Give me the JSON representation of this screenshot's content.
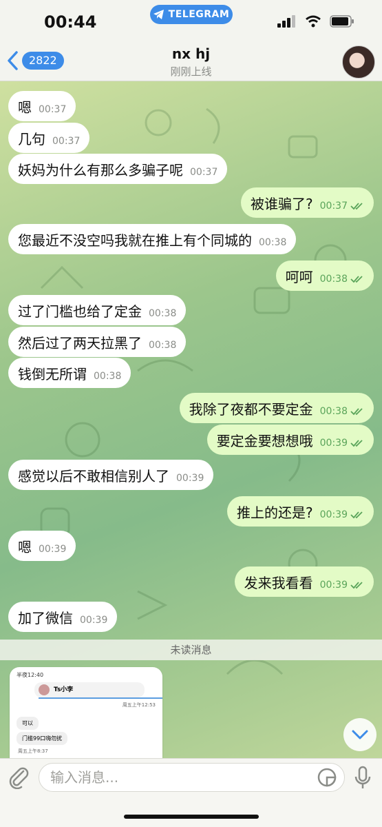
{
  "status": {
    "time": "00:44",
    "app_pill": "TELEGRAM"
  },
  "header": {
    "back_count": "2822",
    "title": "nx hj",
    "subtitle": "刚刚上线"
  },
  "messages": [
    {
      "dir": "in",
      "text": "嗯",
      "time": "00:37"
    },
    {
      "dir": "in",
      "text": "几句",
      "time": "00:37"
    },
    {
      "dir": "in",
      "text": "妖妈为什么有那么多骗子呢",
      "time": "00:37"
    },
    {
      "dir": "out",
      "text": "被谁骗了?",
      "time": "00:37"
    },
    {
      "dir": "in",
      "text": "您最近不没空吗我就在推上有个同城的",
      "time": "00:38"
    },
    {
      "dir": "out",
      "text": "呵呵",
      "time": "00:38"
    },
    {
      "dir": "in",
      "text": "过了门槛也给了定金",
      "time": "00:38"
    },
    {
      "dir": "in",
      "text": "然后过了两天拉黑了",
      "time": "00:38"
    },
    {
      "dir": "in",
      "text": "钱倒无所谓",
      "time": "00:38"
    },
    {
      "dir": "out",
      "text": "我除了夜都不要定金",
      "time": "00:38"
    },
    {
      "dir": "out",
      "text": "要定金要想想哦",
      "time": "00:39"
    },
    {
      "dir": "in",
      "text": "感觉以后不敢相信别人了",
      "time": "00:39"
    },
    {
      "dir": "out",
      "text": "推上的还是?",
      "time": "00:39"
    },
    {
      "dir": "in",
      "text": "嗯",
      "time": "00:39"
    },
    {
      "dir": "out",
      "text": "发来我看看",
      "time": "00:39"
    },
    {
      "dir": "in",
      "text": "加了微信",
      "time": "00:39"
    }
  ],
  "unread_divider": "未读消息",
  "screenshot_preview": {
    "status_time": "半夜12:40",
    "contact": "Ts小李",
    "date_top": "周五上午12:53",
    "bubble1": "可以",
    "bubble2": "门槛99口嗨勿扰",
    "date_bottom": "周五上午8:37"
  },
  "input": {
    "placeholder": "输入消息..."
  },
  "colors": {
    "accent": "#3d8ce8",
    "outgoing_bubble": "#e3fbc6",
    "incoming_bubble": "#ffffff"
  }
}
